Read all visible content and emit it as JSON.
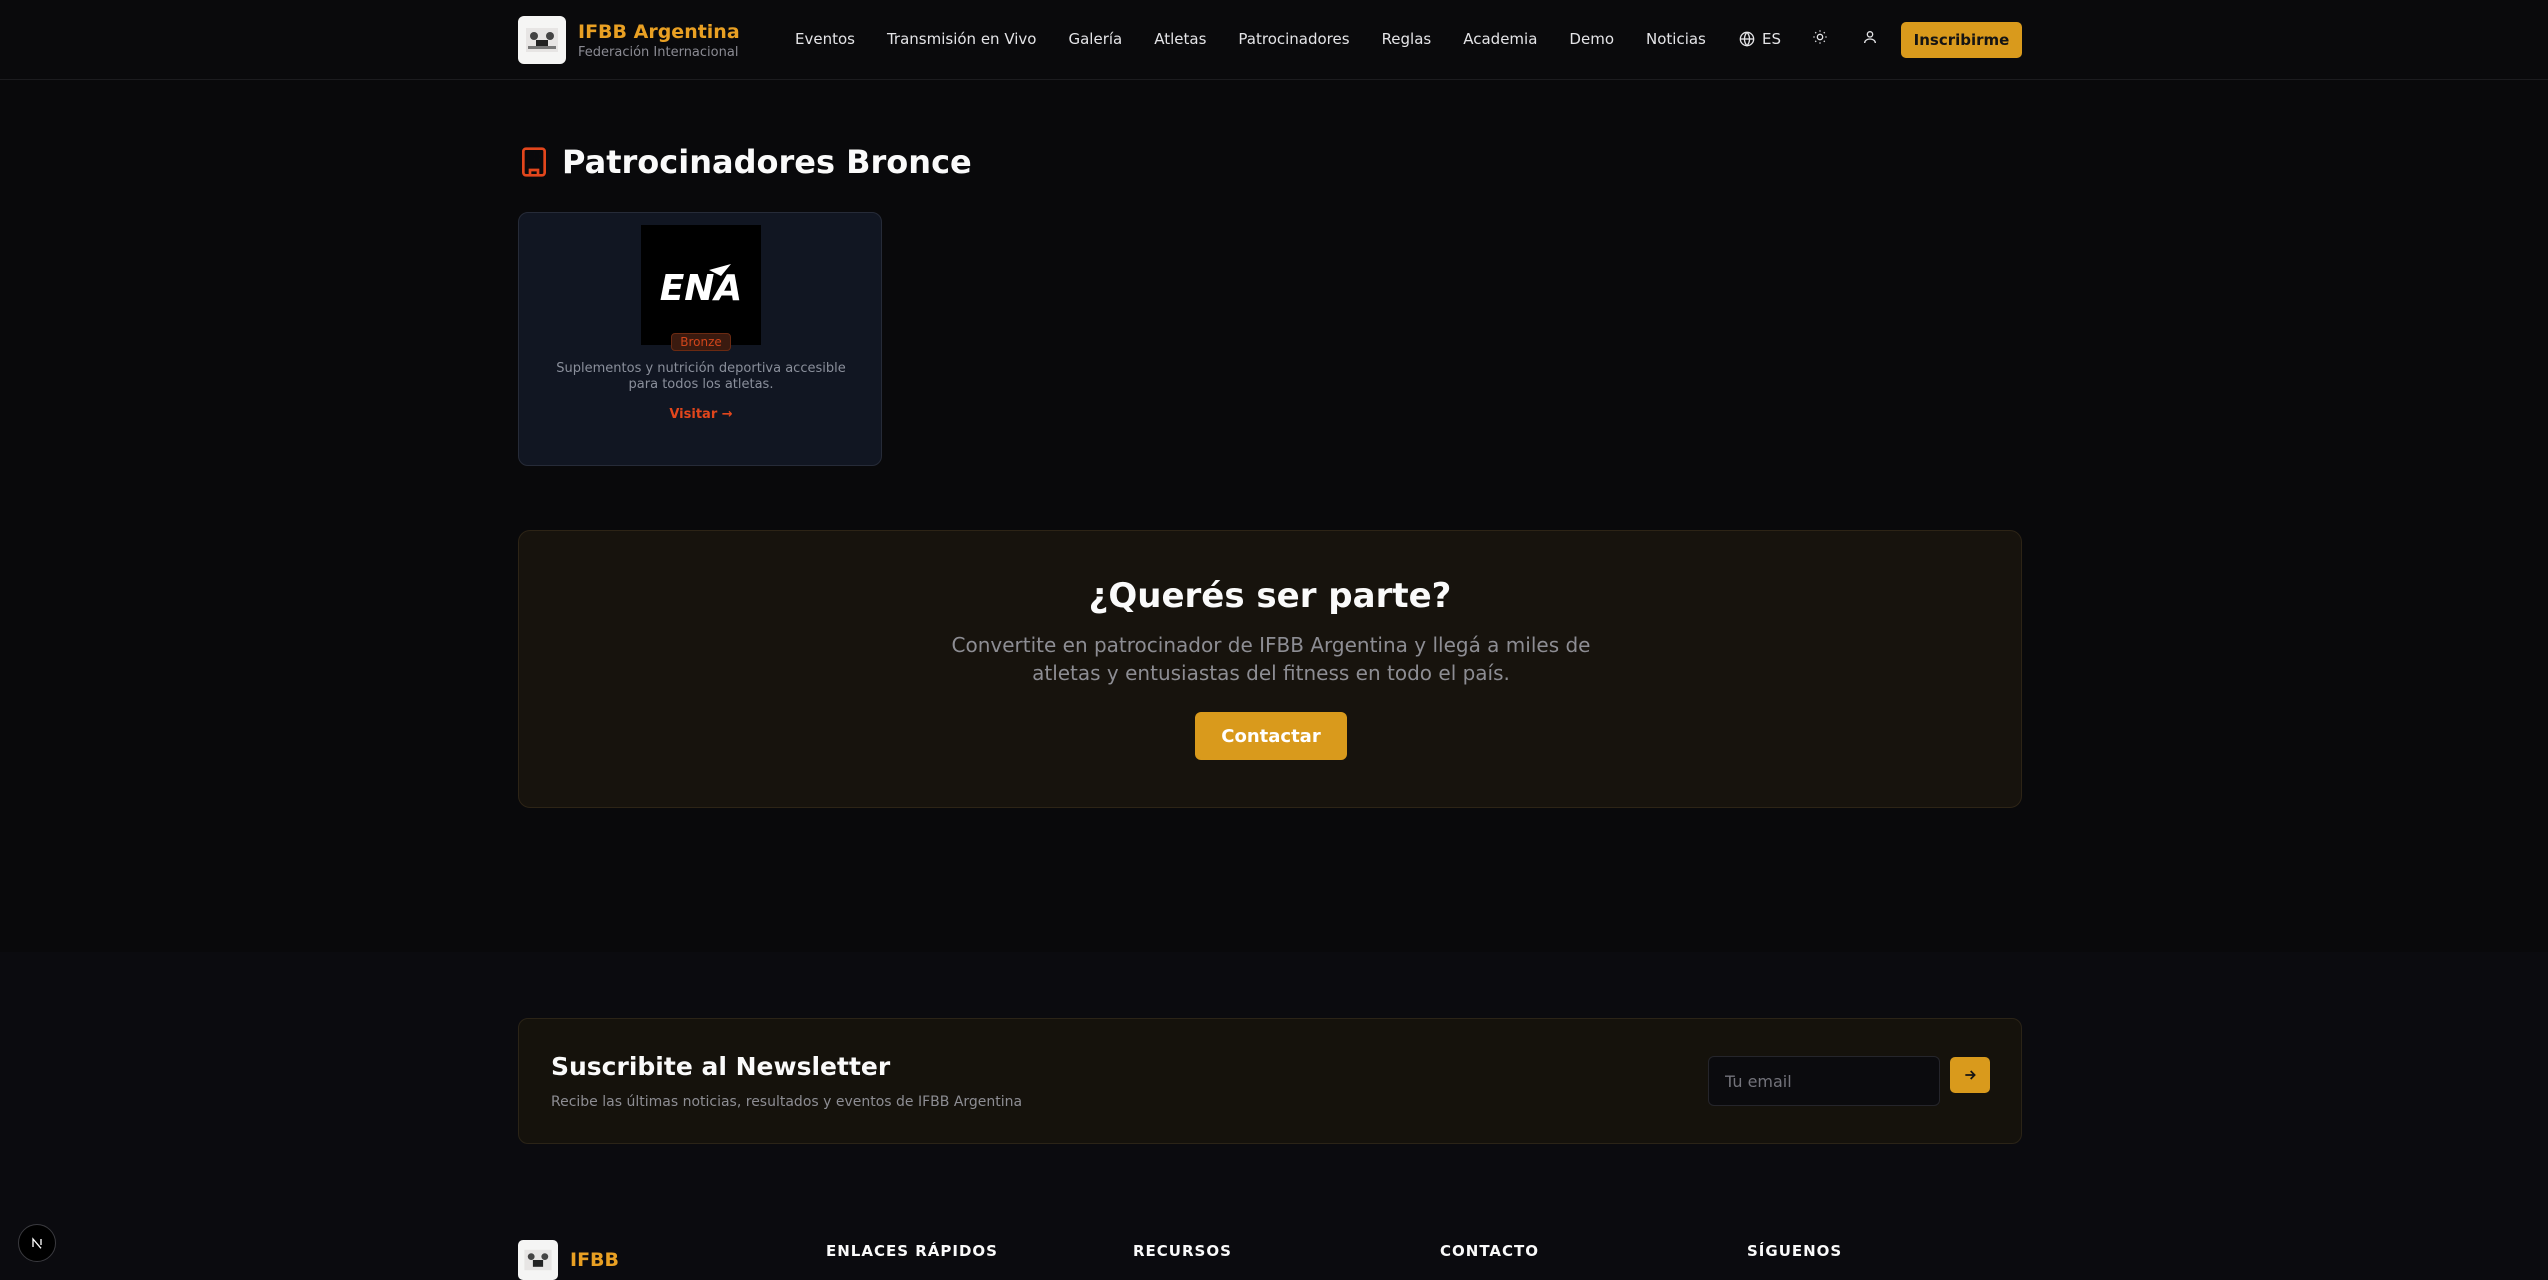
{
  "header": {
    "brand_title": "IFBB Argentina",
    "brand_subtitle": "Federación Internacional",
    "nav": [
      "Eventos",
      "Transmisión en Vivo",
      "Galería",
      "Atletas",
      "Patrocinadores",
      "Reglas",
      "Academia",
      "Demo",
      "Noticias"
    ],
    "language": "ES",
    "cta_label": "Inscribirme",
    "icons": [
      "globe-icon",
      "sun-icon",
      "user-icon"
    ]
  },
  "bronze": {
    "title": "Patrocinadores Bronce",
    "sponsor": {
      "logo_text": "ENA",
      "tier_badge": "Bronze",
      "description": "Suplementos y nutrición deportiva accesible para todos los atletas.",
      "link_label": "Visitar →"
    }
  },
  "join": {
    "title": "¿Querés ser parte?",
    "text": "Convertite en patrocinador de IFBB Argentina y llegá a miles de atletas y entusiastas del fitness en todo el país.",
    "button_label": "Contactar"
  },
  "newsletter": {
    "title": "Suscribite al Newsletter",
    "subtitle": "Recibe las últimas noticias, resultados y eventos de IFBB Argentina",
    "email_placeholder": "Tu email"
  },
  "footer": {
    "brand_name": "IFBB",
    "columns": [
      "ENLACES RÁPIDOS",
      "RECURSOS",
      "CONTACTO",
      "SÍGUENOS"
    ]
  },
  "colors": {
    "accent": "#d99a1c",
    "brand_text": "#e9a023",
    "bronze_link": "#e2461c",
    "background": "#09090b"
  }
}
